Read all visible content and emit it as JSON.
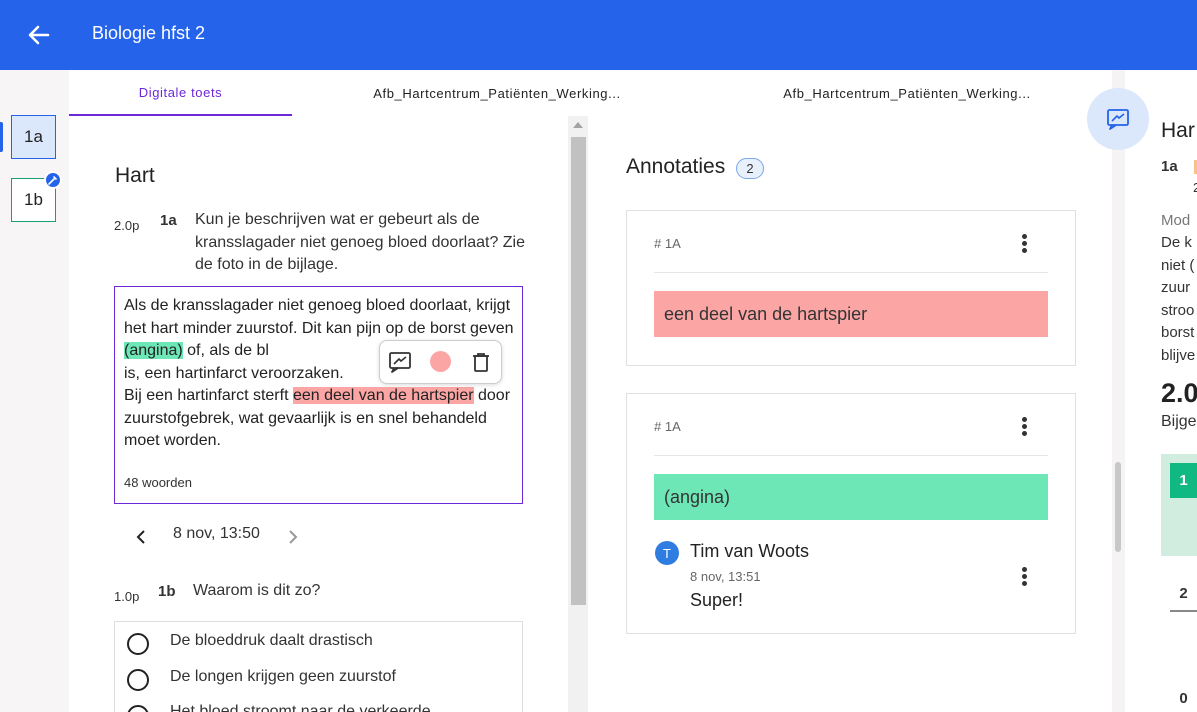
{
  "header": {
    "title": "Biologie hfst 2",
    "back_icon": "arrow-left-icon"
  },
  "question_nav": {
    "items": [
      {
        "label": "1a",
        "state": "active"
      },
      {
        "label": "1b",
        "state": "edited"
      }
    ]
  },
  "tabs": [
    {
      "label": "Digitale toets",
      "active": true
    },
    {
      "label": "Afb_Hartcentrum_Patiënten_Werking...",
      "active": false
    },
    {
      "label": "Afb_Hartcentrum_Patiënten_Werking...",
      "active": false
    }
  ],
  "section": {
    "title": "Hart"
  },
  "question_1a": {
    "points": "2.0p",
    "number": "1a",
    "text": "Kun je beschrijven wat er gebeurt als de kransslagader niet genoeg bloed doorlaat? Zie de foto in de bijlage.",
    "answer": {
      "seg1": "Als de kransslagader niet genoeg bloed doorlaat, krijgt het hart minder zuurstof. Dit kan pijn op de borst geven ",
      "hl_green": "(angina)",
      "seg2": " of, als de bl",
      "seg3": "is, een hartinfarct veroorzaken.",
      "seg4": "Bij een hartinfarct sterft ",
      "hl_red": "een deel van de hartspier",
      "seg5": " door zuurstofgebrek, wat gevaarlijk is en snel behandeld moet worden."
    },
    "word_count": "48 woorden",
    "version_date": "8 nov, 13:50"
  },
  "question_1b": {
    "points": "1.0p",
    "number": "1b",
    "text": "Waarom is dit zo?",
    "options": [
      "De bloeddruk daalt drastisch",
      "De longen krijgen geen zuurstof",
      "Het bloed stroomt naar de verkeerde"
    ]
  },
  "annotations": {
    "title": "Annotaties",
    "count": "2",
    "cards": [
      {
        "tag": "# 1A",
        "quote": "een deel van de hartspier",
        "color": "#fca5a5"
      },
      {
        "tag": "# 1A",
        "quote": "(angina)",
        "color": "#6ee7b7",
        "comment": {
          "avatar": "T",
          "author": "Tim van Woots",
          "time": "8 nov, 13:51",
          "text": "Super!"
        }
      }
    ]
  },
  "right_panel": {
    "title": "Har",
    "qnum": "1a",
    "qnum_line2": "2",
    "model_label": "Mod",
    "lines": [
      "De k",
      "niet (",
      "zuur",
      "stroo",
      "borst",
      "blijve"
    ],
    "score": "2.0",
    "bij_label": "Bijge",
    "chips": [
      "1",
      "2",
      "0"
    ]
  },
  "colors": {
    "primary": "#2563eb",
    "tab_active": "#6d28d9",
    "highlight_green": "#6ee7b7",
    "highlight_red": "#fca5a5"
  }
}
